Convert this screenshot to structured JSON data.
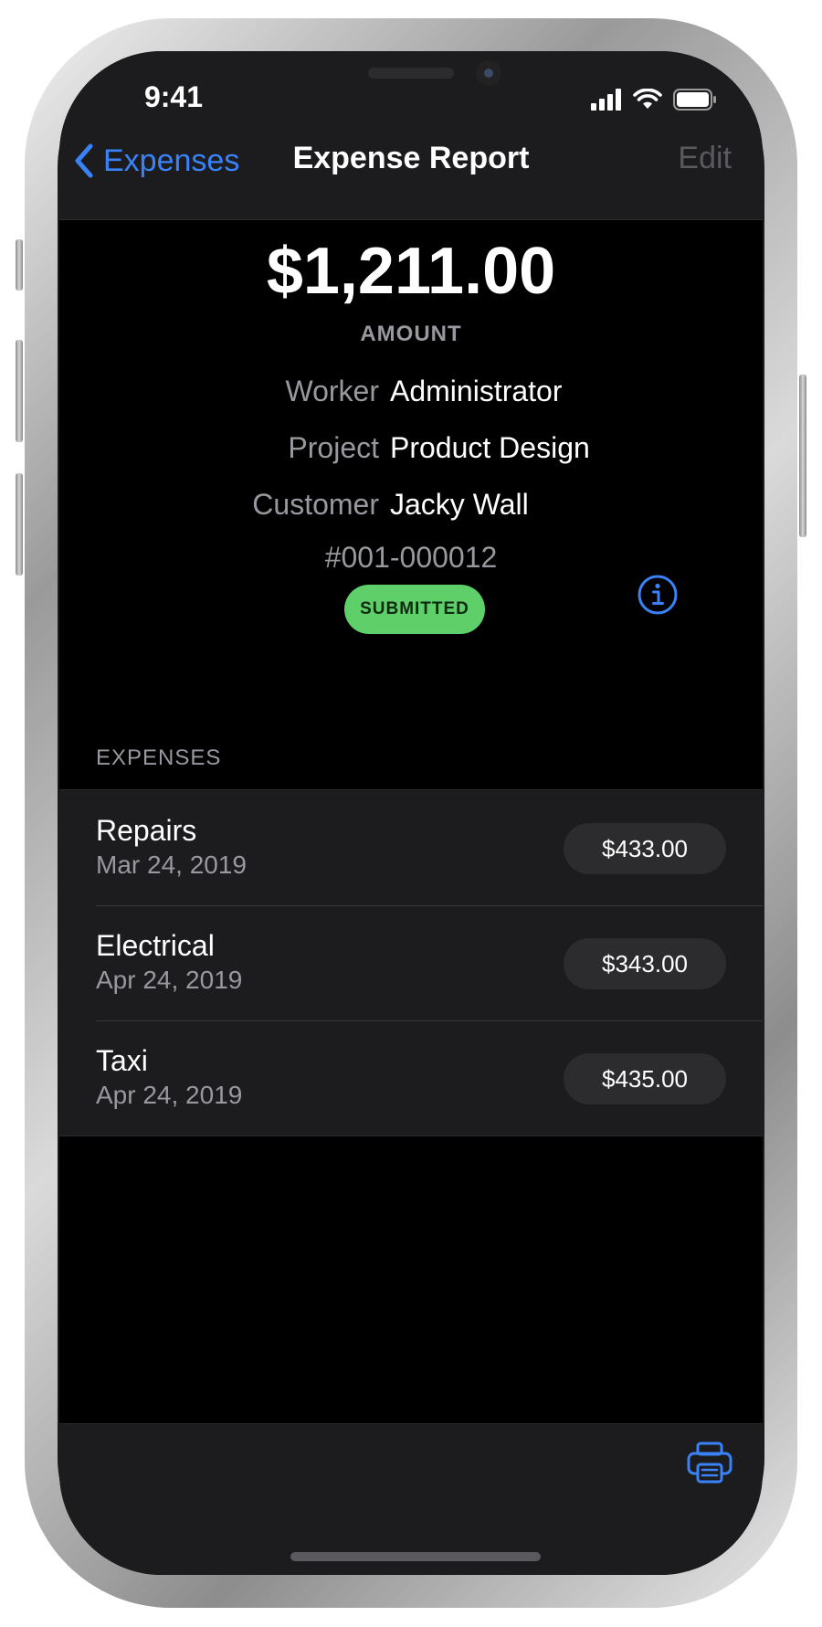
{
  "status_bar": {
    "time": "9:41"
  },
  "nav": {
    "back_label": "Expenses",
    "title": "Expense Report",
    "edit_label": "Edit"
  },
  "summary": {
    "amount": "$1,211.00",
    "amount_label": "AMOUNT",
    "fields": [
      {
        "label": "Worker",
        "value": "Administrator"
      },
      {
        "label": "Project",
        "value": "Product Design"
      },
      {
        "label": "Customer",
        "value": "Jacky Wall"
      }
    ],
    "report_number": "#001-000012",
    "status": "SUBMITTED"
  },
  "expenses": {
    "header": "EXPENSES",
    "items": [
      {
        "title": "Repairs",
        "date": "Mar 24, 2019",
        "amount": "$433.00"
      },
      {
        "title": "Electrical",
        "date": "Apr 24, 2019",
        "amount": "$343.00"
      },
      {
        "title": "Taxi",
        "date": "Apr 24, 2019",
        "amount": "$435.00"
      }
    ]
  },
  "icons": {
    "back": "chevron-left-icon",
    "info": "info-circle-icon",
    "print": "printer-icon",
    "signal": "cellular-signal-icon",
    "wifi": "wifi-icon",
    "battery": "battery-icon"
  },
  "colors": {
    "accent": "#3a82f7",
    "status_submitted": "#5fcf6a",
    "background": "#000000",
    "surface": "#1c1c1e",
    "secondary_text": "#98989f"
  }
}
